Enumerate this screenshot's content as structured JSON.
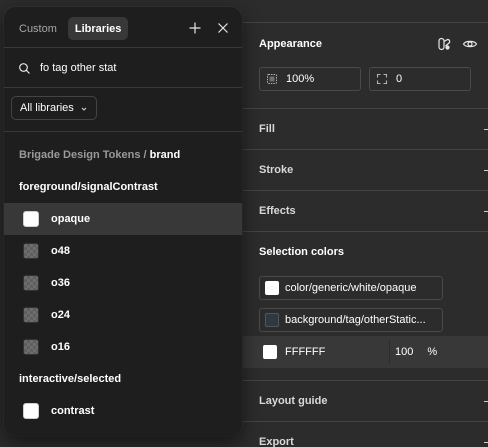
{
  "popover": {
    "tabs": [
      {
        "label": "Custom",
        "active": false
      },
      {
        "label": "Libraries",
        "active": true
      }
    ],
    "add_icon": "plus-icon",
    "close_icon": "close-icon",
    "search": {
      "icon": "search-icon",
      "value": "fo tag other stat"
    },
    "library_filter": {
      "label": "All libraries",
      "icon": "chevron-down-icon"
    },
    "path": {
      "library": "Brigade Design Tokens",
      "separator": "/",
      "collection": "brand"
    },
    "groups": [
      {
        "title": "foreground/signalContrast",
        "items": [
          {
            "label": "opaque",
            "swatch": "solid",
            "selected": true
          },
          {
            "label": "o48",
            "swatch": "checker",
            "selected": false
          },
          {
            "label": "o36",
            "swatch": "checker",
            "selected": false
          },
          {
            "label": "o24",
            "swatch": "checker",
            "selected": false
          },
          {
            "label": "o16",
            "swatch": "checker",
            "selected": false
          }
        ]
      },
      {
        "title": "interactive/selected",
        "items": [
          {
            "label": "contrast",
            "swatch": "solid",
            "selected": false
          }
        ]
      }
    ]
  },
  "design_panel": {
    "appearance": {
      "title": "Appearance",
      "icons": [
        "variable-mode-icon",
        "eye-icon"
      ],
      "opacity": {
        "icon": "opacity-icon",
        "value": "100%"
      },
      "corner_radius": {
        "icon": "corner-radius-icon",
        "value": "0"
      }
    },
    "sections": [
      "Fill",
      "Stroke",
      "Effects"
    ],
    "selection_colors": {
      "title": "Selection colors",
      "chips": [
        {
          "label": "color/generic/white/opaque",
          "swatch_color": "#ffffff"
        },
        {
          "label": "background/tag/otherStatic...",
          "swatch_color": "#2f3646"
        }
      ],
      "hex": {
        "value": "FFFFFF",
        "swatch_color": "#ffffff",
        "opacity": "100",
        "unit": "%"
      }
    },
    "layout_guide": "Layout guide",
    "export": "Export"
  },
  "colors": {
    "panel_bg": "#2c2c2c",
    "popover_bg": "#1e1e1e",
    "selected_row_bg": "#383838",
    "divider": "#444444"
  }
}
